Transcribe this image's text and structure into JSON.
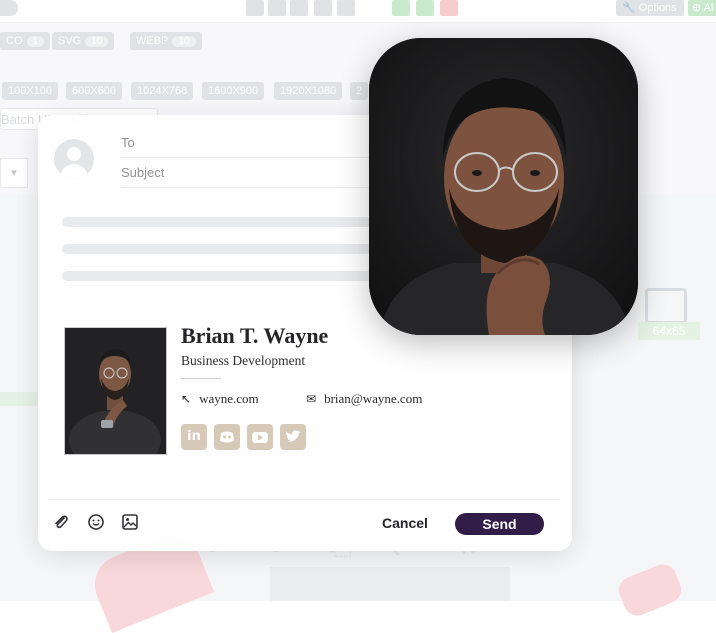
{
  "background": {
    "format_tags": [
      {
        "label": "CO",
        "count": "1"
      },
      {
        "label": "SVG",
        "count": "10"
      },
      {
        "label": "WEBP",
        "count": "10"
      }
    ],
    "sizes": [
      "100X100",
      "600X600",
      "1024X768",
      "1600X900",
      "1920X1080",
      "2"
    ],
    "batch_placeholder": "Batch URL address",
    "options_label": "Options",
    "all_label": "Al",
    "size_badge": "64x65"
  },
  "email": {
    "to_label": "To",
    "subject_label": "Subject",
    "cancel_label": "Cancel",
    "send_label": "Send"
  },
  "signature": {
    "name": "Brian T. Wayne",
    "title": "Business Development",
    "website": "wayne.com",
    "email": "brian@wayne.com",
    "socials": [
      "linkedin",
      "discord",
      "youtube",
      "twitter"
    ]
  },
  "colors": {
    "send_button": "#2b1743",
    "social_icon": "#d6c8b6"
  },
  "icons": [
    "cursor-icon",
    "envelope-icon",
    "paperclip-icon",
    "emoji-icon",
    "image-icon"
  ]
}
